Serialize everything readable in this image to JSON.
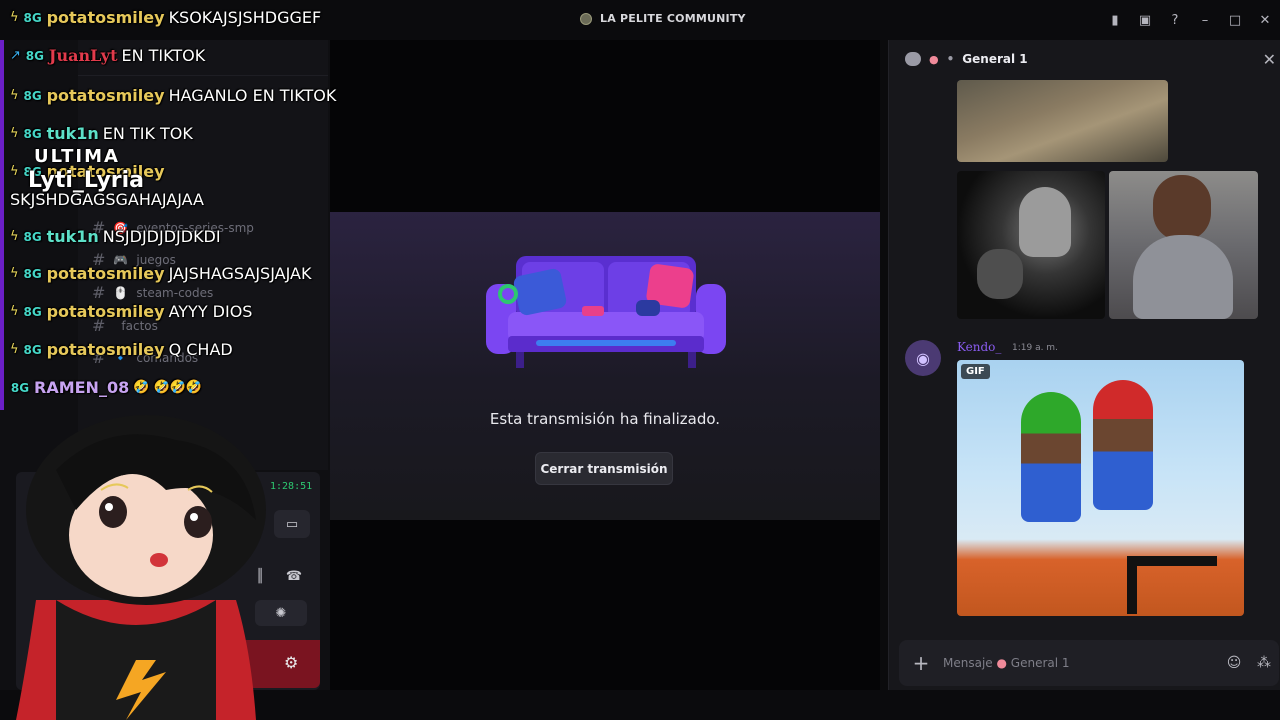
{
  "titlebar": {
    "server_name": "LA PELITE COMMUNITY",
    "icons": [
      "bookmark-icon",
      "screen-icon",
      "help-icon",
      "minimize-icon",
      "maximize-icon"
    ]
  },
  "channels": [
    {
      "name": "eventos-series-smp",
      "prefix": "🎯"
    },
    {
      "name": "juegos",
      "prefix": "🎮"
    },
    {
      "name": "steam-codes",
      "prefix": "🖱️"
    },
    {
      "name": "factos",
      "prefix": ""
    },
    {
      "name": "comandos",
      "prefix": "🔹"
    }
  ],
  "call": {
    "timer": "1:28:51"
  },
  "stream": {
    "ended_text": "Esta transmisión ha finalizado.",
    "close_label": "Cerrar transmisión"
  },
  "chat": {
    "channel_name": "General 1",
    "message": {
      "author": "Kendo_",
      "time": "1:19 a. m.",
      "gif_badge": "GIF"
    },
    "input_placeholder": "Mensaje",
    "input_channel": "General 1"
  },
  "overlay_chat": [
    {
      "user": "potatosmiley",
      "text": "KSOKAJSJSHDGGEF",
      "color": "#e6c85a"
    },
    {
      "user": "JuanLyt",
      "text": "EN TIKTOK",
      "color": "#e23b4c"
    },
    {
      "user": "potatosmiley",
      "text": "HAGANLO EN TIKTOK",
      "color": "#e6c85a"
    },
    {
      "user": "tuk1n",
      "text": "EN TIK TOK",
      "color": "#5de0c8"
    },
    {
      "user": "potatosmiley",
      "text": "",
      "color": "#e6c85a"
    },
    {
      "user": "",
      "text": "SKJSHDGAGSGAHAJAJAA",
      "color": "#ffffff"
    },
    {
      "user": "tuk1n",
      "text": "NSJDJDJDJDKDI",
      "color": "#5de0c8"
    },
    {
      "user": "potatosmiley",
      "text": "JAJSHAGSAJSJAJAK",
      "color": "#e6c85a"
    },
    {
      "user": "potatosmiley",
      "text": "AYYY DIOS",
      "color": "#e6c85a"
    },
    {
      "user": "potatosmiley",
      "text": "Q CHAD",
      "color": "#e6c85a"
    },
    {
      "user": "RAMEN_08",
      "text": "🤣 🤣🤣🤣",
      "color": "#c7a3f0"
    }
  ],
  "overlay_name": "Lyti_Lyria",
  "overlay_tag": "ULTIMA",
  "colors": {
    "accent": "#5865f2",
    "stream_card_top": "#2b2340",
    "author": "#8a5cf0",
    "call_time": "#2dc770"
  }
}
